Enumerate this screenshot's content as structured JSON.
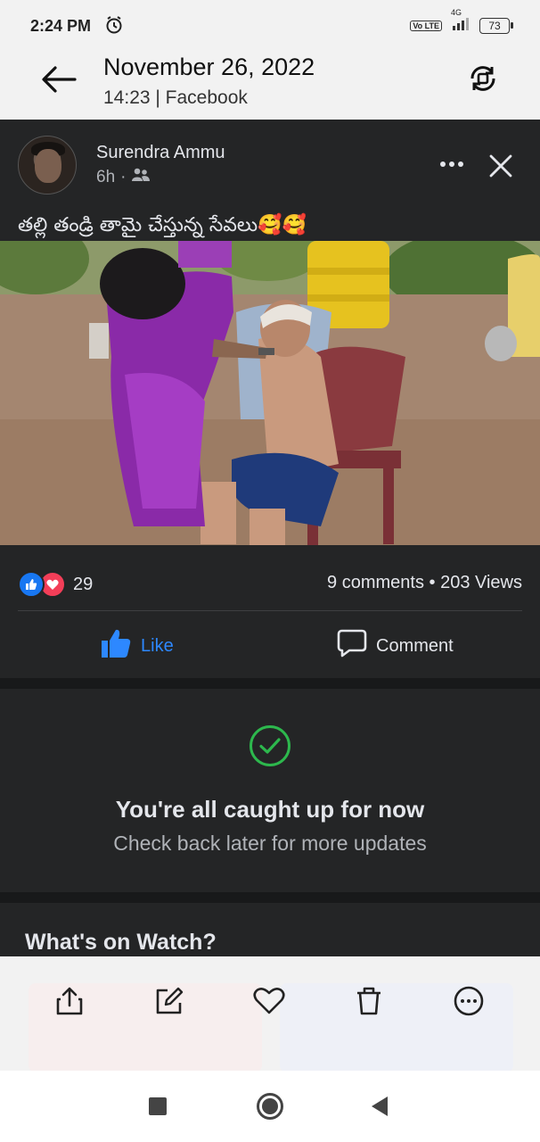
{
  "status_bar": {
    "time": "2:24 PM",
    "network": "4G",
    "volte": "Vo LTE",
    "battery": "73"
  },
  "header": {
    "date": "November 26, 2022",
    "subtitle": "14:23 | Facebook"
  },
  "post": {
    "author": "Surendra Ammu",
    "time": "6h",
    "audience_icon": "friends-icon",
    "caption": "తల్లి తండ్రి తామై చేస్తున్న సేవలు🥰🥰",
    "reaction_count": "29",
    "stats": "9 comments • 203 Views",
    "like_label": "Like",
    "comment_label": "Comment"
  },
  "feed_end": {
    "title": "You're all caught up for now",
    "subtitle": "Check back later for more updates"
  },
  "watch": {
    "title": "What's on Watch?"
  },
  "colors": {
    "post_bg": "#242526",
    "like_blue": "#2d88ff",
    "check_green": "#2db84d",
    "love_red": "#f33e58"
  },
  "toolbar_icons": [
    "share-icon",
    "edit-icon",
    "favorite-icon",
    "delete-icon",
    "more-options-icon"
  ]
}
